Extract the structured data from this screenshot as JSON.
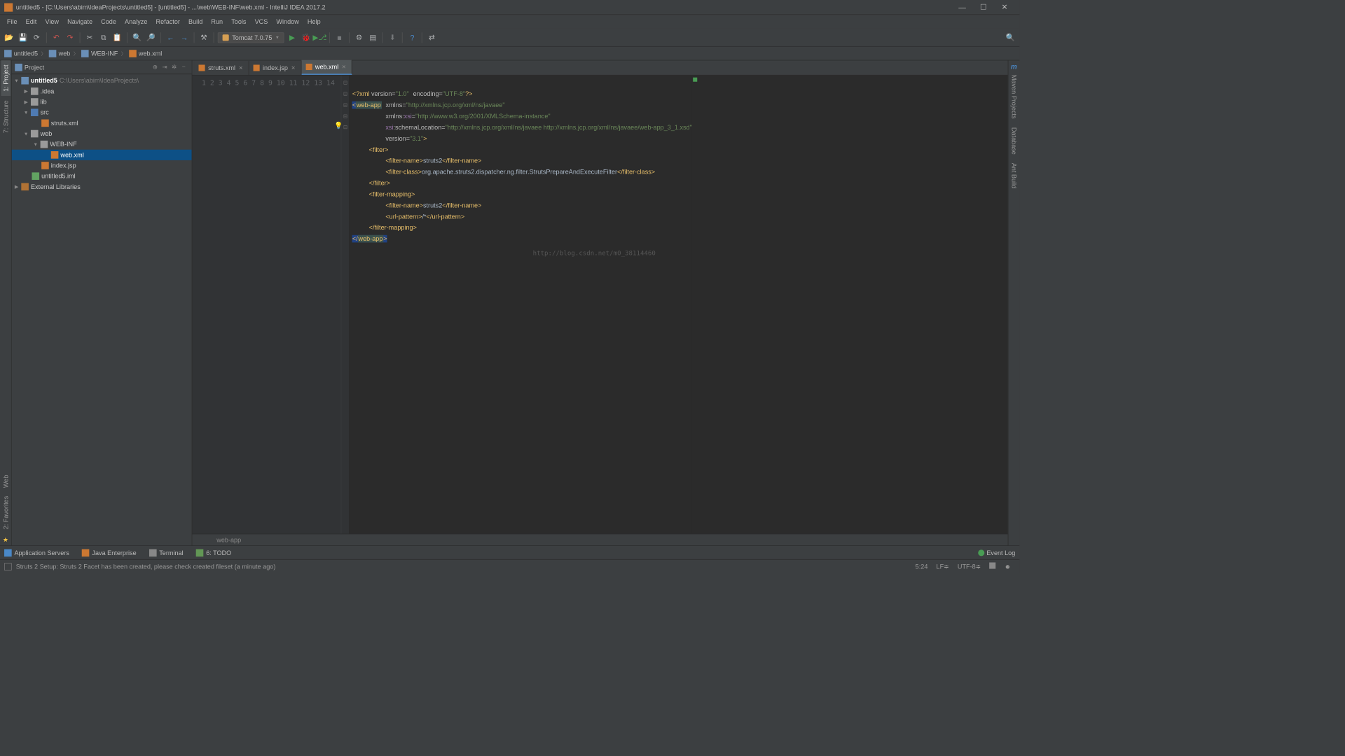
{
  "window": {
    "title": "untitled5 - [C:\\Users\\abim\\IdeaProjects\\untitled5] - [untitled5] - ...\\web\\WEB-INF\\web.xml - IntelliJ IDEA 2017.2"
  },
  "menu": [
    "File",
    "Edit",
    "View",
    "Navigate",
    "Code",
    "Analyze",
    "Refactor",
    "Build",
    "Run",
    "Tools",
    "VCS",
    "Window",
    "Help"
  ],
  "runconfig": {
    "label": "Tomcat 7.0.75"
  },
  "breadcrumbs": [
    "untitled5",
    "web",
    "WEB-INF",
    "web.xml"
  ],
  "project": {
    "title": "Project",
    "root": {
      "name": "untitled5",
      "path": "C:\\Users\\abim\\IdeaProjects\\"
    },
    "nodes": {
      "idea": ".idea",
      "lib": "lib",
      "src": "src",
      "struts": "struts.xml",
      "web": "web",
      "webinf": "WEB-INF",
      "webxml": "web.xml",
      "indexjsp": "index.jsp",
      "iml": "untitled5.iml",
      "ext": "External Libraries"
    }
  },
  "tabs": [
    {
      "label": "struts.xml",
      "active": false
    },
    {
      "label": "index.jsp",
      "active": false
    },
    {
      "label": "web.xml",
      "active": true
    }
  ],
  "code": {
    "lines": [
      1,
      2,
      3,
      4,
      5,
      6,
      7,
      8,
      9,
      10,
      11,
      12,
      13,
      14
    ],
    "l1": {
      "pre": "<?xml ",
      "a1": "version",
      "v1": "\"1.0\"",
      "a2": "encoding",
      "v2": "\"UTF-8\"",
      "post": "?>"
    },
    "l2": {
      "tag": "web-app",
      "a": "xmlns",
      "v": "\"http://xmlns.jcp.org/xml/ns/javaee\""
    },
    "l3": {
      "a": "xmlns:",
      "ns": "xsi",
      "v": "\"http://www.w3.org/2001/XMLSchema-instance\""
    },
    "l4": {
      "ns": "xsi",
      "a": ":schemaLocation",
      "v": "\"http://xmlns.jcp.org/xml/ns/javaee http://xmlns.jcp.org/xml/ns/javaee/web-app_3_1.xsd\""
    },
    "l5": {
      "a": "version",
      "v": "\"3.1\"",
      "c": ">"
    },
    "l6": {
      "o": "<filter>"
    },
    "l7": {
      "o": "<filter-name>",
      "t": "struts2",
      "c": "</filter-name>"
    },
    "l8": {
      "o": "<filter-class>",
      "t": "org.apache.struts2.dispatcher.ng.filter.StrutsPrepareAndExecuteFilter",
      "c": "</filter-class>"
    },
    "l9": {
      "c": "</filter>"
    },
    "l10": {
      "o": "<filter-mapping>"
    },
    "l11": {
      "o": "<filter-name>",
      "t": "struts2",
      "c": "</filter-name>"
    },
    "l12": {
      "o": "<url-pattern>",
      "t": "/*",
      "c": "</url-pattern>"
    },
    "l13": {
      "c": "</filter-mapping>"
    },
    "l14": {
      "c": "</web-app>"
    },
    "watermark": "http://blog.csdn.net/m0_38114460",
    "context": "web-app"
  },
  "left_tabs": [
    "1: Project",
    "7: Structure"
  ],
  "left_tabs2": [
    "Web",
    "2: Favorites"
  ],
  "right_tabs": [
    "Maven Projects",
    "Database",
    "Ant Build"
  ],
  "bottom_tabs": [
    {
      "l": "Application Servers"
    },
    {
      "l": "Java Enterprise"
    },
    {
      "l": "Terminal"
    },
    {
      "l": "6: TODO"
    }
  ],
  "eventlog": "Event Log",
  "status": {
    "msg": "Struts 2 Setup: Struts 2 Facet has been created, please check created fileset (a minute ago)",
    "pos": "5:24",
    "sep": "LF",
    "enc": "UTF-8"
  }
}
